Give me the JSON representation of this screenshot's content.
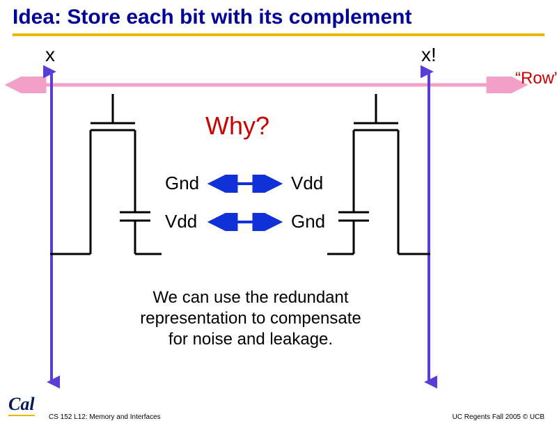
{
  "title": "Idea: Store each bit with its complement",
  "labels": {
    "x": "x",
    "xbar": "x!",
    "row": "“Row”",
    "why": "Why?",
    "gnd": "Gnd",
    "vdd": "Vdd"
  },
  "description_lines": {
    "l1": "We can use the redundant",
    "l2": "representation to compensate",
    "l3": "for noise and leakage."
  },
  "footer": {
    "left": "CS 152 L12: Memory and Interfaces",
    "right": "UC Regents Fall 2005 © UCB"
  },
  "logo": "Cal"
}
